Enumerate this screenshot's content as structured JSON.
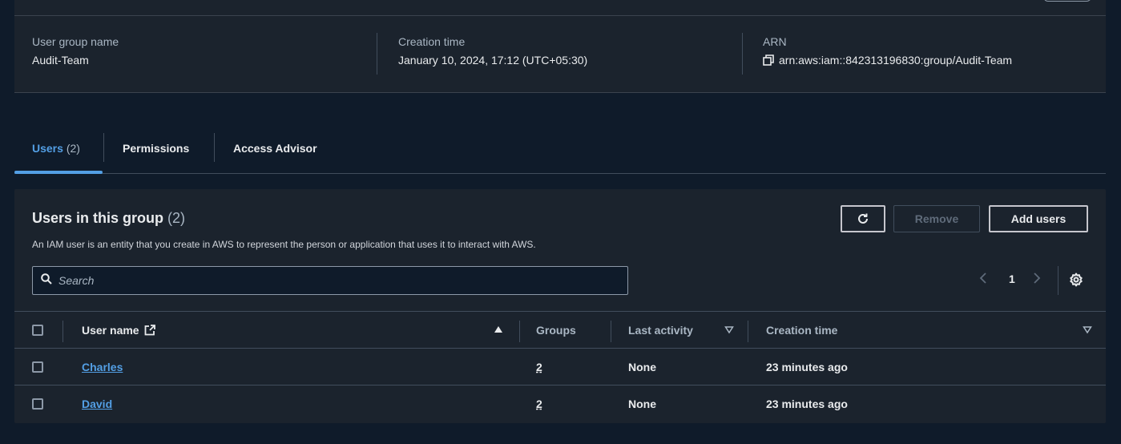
{
  "summary": {
    "group_name_label": "User group name",
    "group_name_value": "Audit-Team",
    "creation_label": "Creation time",
    "creation_value": "January 10, 2024, 17:12 (UTC+05:30)",
    "arn_label": "ARN",
    "arn_value": "arn:aws:iam::842313196830:group/Audit-Team"
  },
  "tabs": [
    {
      "label": "Users",
      "count": "(2)"
    },
    {
      "label": "Permissions"
    },
    {
      "label": "Access Advisor"
    }
  ],
  "panel": {
    "title": "Users in this group",
    "count": "(2)",
    "description": "An IAM user is an entity that you create in AWS to represent the person or application that uses it to interact with AWS.",
    "remove_label": "Remove",
    "add_label": "Add users",
    "search_placeholder": "Search",
    "page_number": "1"
  },
  "table": {
    "columns": [
      "User name",
      "Groups",
      "Last activity",
      "Creation time"
    ],
    "rows": [
      {
        "user": "Charles",
        "groups": "2",
        "last_activity": "None",
        "created": "23 minutes ago"
      },
      {
        "user": "David",
        "groups": "2",
        "last_activity": "None",
        "created": "23 minutes ago"
      }
    ]
  },
  "colors": {
    "background": "#0f1b2a",
    "panel": "#1b232d",
    "accent": "#539fe5",
    "border": "#414d5c"
  },
  "icons": [
    "copy-icon",
    "refresh-icon",
    "search-icon",
    "gear-icon",
    "external-link-icon",
    "sort-ascending-icon",
    "sort-descending-icon",
    "chevron-left-icon",
    "chevron-right-icon"
  ]
}
